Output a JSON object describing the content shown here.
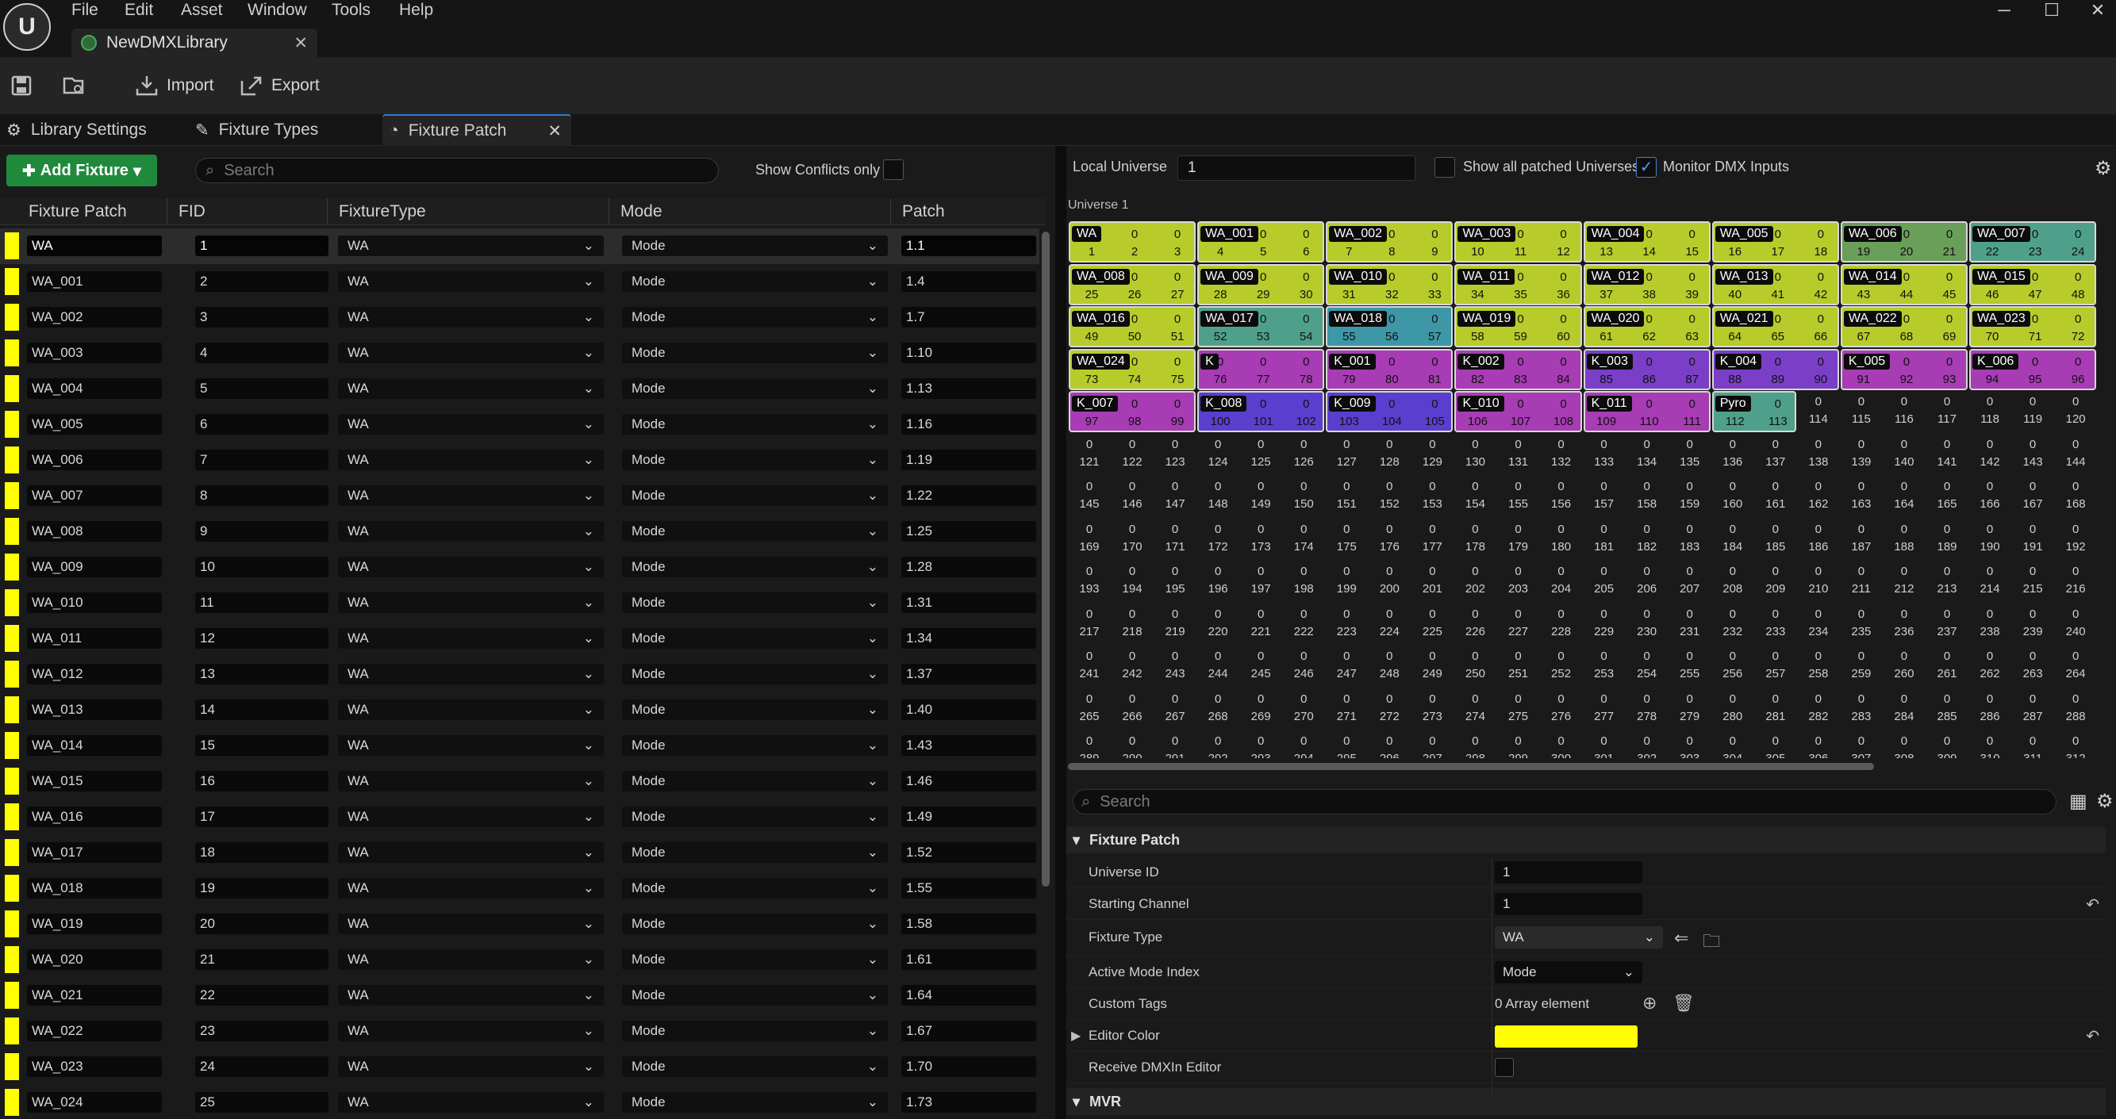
{
  "menu": [
    "File",
    "Edit",
    "Asset",
    "Window",
    "Tools",
    "Help"
  ],
  "logo_text": "U",
  "window_controls": {
    "minimize": "─",
    "maximize": "☐",
    "close": "✕"
  },
  "doc_tab": {
    "title": "NewDMXLibrary",
    "close": "✕"
  },
  "toolbar": {
    "import_label": "Import",
    "export_label": "Export"
  },
  "panel_tabs": {
    "library_settings": "Library Settings",
    "fixture_types": "Fixture Types",
    "fixture_patch": "Fixture Patch",
    "close": "✕"
  },
  "left": {
    "add_fixture_label": "Add Fixture",
    "search_placeholder": "Search",
    "show_conflicts_label": "Show Conflicts only",
    "columns": [
      "Fixture Patch",
      "FID",
      "FixtureType",
      "Mode",
      "Patch"
    ],
    "rows": [
      {
        "name": "WA",
        "fid": "1",
        "type": "WA",
        "mode": "Mode",
        "patch": "1.1"
      },
      {
        "name": "WA_001",
        "fid": "2",
        "type": "WA",
        "mode": "Mode",
        "patch": "1.4"
      },
      {
        "name": "WA_002",
        "fid": "3",
        "type": "WA",
        "mode": "Mode",
        "patch": "1.7"
      },
      {
        "name": "WA_003",
        "fid": "4",
        "type": "WA",
        "mode": "Mode",
        "patch": "1.10"
      },
      {
        "name": "WA_004",
        "fid": "5",
        "type": "WA",
        "mode": "Mode",
        "patch": "1.13"
      },
      {
        "name": "WA_005",
        "fid": "6",
        "type": "WA",
        "mode": "Mode",
        "patch": "1.16"
      },
      {
        "name": "WA_006",
        "fid": "7",
        "type": "WA",
        "mode": "Mode",
        "patch": "1.19"
      },
      {
        "name": "WA_007",
        "fid": "8",
        "type": "WA",
        "mode": "Mode",
        "patch": "1.22"
      },
      {
        "name": "WA_008",
        "fid": "9",
        "type": "WA",
        "mode": "Mode",
        "patch": "1.25"
      },
      {
        "name": "WA_009",
        "fid": "10",
        "type": "WA",
        "mode": "Mode",
        "patch": "1.28"
      },
      {
        "name": "WA_010",
        "fid": "11",
        "type": "WA",
        "mode": "Mode",
        "patch": "1.31"
      },
      {
        "name": "WA_011",
        "fid": "12",
        "type": "WA",
        "mode": "Mode",
        "patch": "1.34"
      },
      {
        "name": "WA_012",
        "fid": "13",
        "type": "WA",
        "mode": "Mode",
        "patch": "1.37"
      },
      {
        "name": "WA_013",
        "fid": "14",
        "type": "WA",
        "mode": "Mode",
        "patch": "1.40"
      },
      {
        "name": "WA_014",
        "fid": "15",
        "type": "WA",
        "mode": "Mode",
        "patch": "1.43"
      },
      {
        "name": "WA_015",
        "fid": "16",
        "type": "WA",
        "mode": "Mode",
        "patch": "1.46"
      },
      {
        "name": "WA_016",
        "fid": "17",
        "type": "WA",
        "mode": "Mode",
        "patch": "1.49"
      },
      {
        "name": "WA_017",
        "fid": "18",
        "type": "WA",
        "mode": "Mode",
        "patch": "1.52"
      },
      {
        "name": "WA_018",
        "fid": "19",
        "type": "WA",
        "mode": "Mode",
        "patch": "1.55"
      },
      {
        "name": "WA_019",
        "fid": "20",
        "type": "WA",
        "mode": "Mode",
        "patch": "1.58"
      },
      {
        "name": "WA_020",
        "fid": "21",
        "type": "WA",
        "mode": "Mode",
        "patch": "1.61"
      },
      {
        "name": "WA_021",
        "fid": "22",
        "type": "WA",
        "mode": "Mode",
        "patch": "1.64"
      },
      {
        "name": "WA_022",
        "fid": "23",
        "type": "WA",
        "mode": "Mode",
        "patch": "1.67"
      },
      {
        "name": "WA_023",
        "fid": "24",
        "type": "WA",
        "mode": "Mode",
        "patch": "1.70"
      },
      {
        "name": "WA_024",
        "fid": "25",
        "type": "WA",
        "mode": "Mode",
        "patch": "1.73"
      }
    ]
  },
  "right": {
    "local_universe_label": "Local Universe",
    "local_universe_value": "1",
    "show_all_label": "Show all patched Universes",
    "monitor_label": "Monitor DMX Inputs",
    "monitor_checked": true,
    "universe_title": "Universe 1",
    "channel_value": "0",
    "patches": [
      {
        "label": "WA",
        "start": 1,
        "count": 3,
        "color": "#b7cc2a"
      },
      {
        "label": "WA_001",
        "start": 4,
        "count": 3,
        "color": "#b7cc2a"
      },
      {
        "label": "WA_002",
        "start": 7,
        "count": 3,
        "color": "#b7cc2a"
      },
      {
        "label": "WA_003",
        "start": 10,
        "count": 3,
        "color": "#b7cc2a"
      },
      {
        "label": "WA_004",
        "start": 13,
        "count": 3,
        "color": "#b7cc2a"
      },
      {
        "label": "WA_005",
        "start": 16,
        "count": 3,
        "color": "#b7cc2a"
      },
      {
        "label": "WA_006",
        "start": 19,
        "count": 3,
        "color": "#6a9f5a"
      },
      {
        "label": "WA_007",
        "start": 22,
        "count": 3,
        "color": "#4fa08a"
      },
      {
        "label": "WA_008",
        "start": 25,
        "count": 3,
        "color": "#b7cc2a"
      },
      {
        "label": "WA_009",
        "start": 28,
        "count": 3,
        "color": "#b7cc2a"
      },
      {
        "label": "WA_010",
        "start": 31,
        "count": 3,
        "color": "#b7cc2a"
      },
      {
        "label": "WA_011",
        "start": 34,
        "count": 3,
        "color": "#b7cc2a"
      },
      {
        "label": "WA_012",
        "start": 37,
        "count": 3,
        "color": "#b7cc2a"
      },
      {
        "label": "WA_013",
        "start": 40,
        "count": 3,
        "color": "#b7cc2a"
      },
      {
        "label": "WA_014",
        "start": 43,
        "count": 3,
        "color": "#b7cc2a"
      },
      {
        "label": "WA_015",
        "start": 46,
        "count": 3,
        "color": "#b7cc2a"
      },
      {
        "label": "WA_016",
        "start": 49,
        "count": 3,
        "color": "#b7cc2a"
      },
      {
        "label": "WA_017",
        "start": 52,
        "count": 3,
        "color": "#4fa08a"
      },
      {
        "label": "WA_018",
        "start": 55,
        "count": 3,
        "color": "#3d97a7"
      },
      {
        "label": "WA_019",
        "start": 58,
        "count": 3,
        "color": "#b7cc2a"
      },
      {
        "label": "WA_020",
        "start": 61,
        "count": 3,
        "color": "#b7cc2a"
      },
      {
        "label": "WA_021",
        "start": 64,
        "count": 3,
        "color": "#b7cc2a"
      },
      {
        "label": "WA_022",
        "start": 67,
        "count": 3,
        "color": "#b7cc2a"
      },
      {
        "label": "WA_023",
        "start": 70,
        "count": 3,
        "color": "#b7cc2a"
      },
      {
        "label": "WA_024",
        "start": 73,
        "count": 3,
        "color": "#b7cc2a"
      },
      {
        "label": "K",
        "start": 76,
        "count": 3,
        "color": "#a83cb5"
      },
      {
        "label": "K_001",
        "start": 79,
        "count": 3,
        "color": "#a83cb5"
      },
      {
        "label": "K_002",
        "start": 82,
        "count": 3,
        "color": "#a83cb5"
      },
      {
        "label": "K_003",
        "start": 85,
        "count": 3,
        "color": "#7a3fc6"
      },
      {
        "label": "K_004",
        "start": 88,
        "count": 3,
        "color": "#7a3fc6"
      },
      {
        "label": "K_005",
        "start": 91,
        "count": 3,
        "color": "#a83cb5"
      },
      {
        "label": "K_006",
        "start": 94,
        "count": 3,
        "color": "#a83cb5"
      },
      {
        "label": "K_007",
        "start": 97,
        "count": 3,
        "color": "#a83cb5"
      },
      {
        "label": "K_008",
        "start": 100,
        "count": 3,
        "color": "#5a3fcf"
      },
      {
        "label": "K_009",
        "start": 103,
        "count": 3,
        "color": "#5a3fcf"
      },
      {
        "label": "K_010",
        "start": 106,
        "count": 3,
        "color": "#a83cb5"
      },
      {
        "label": "K_011",
        "start": 109,
        "count": 3,
        "color": "#a83cb5"
      },
      {
        "label": "Pyro",
        "start": 112,
        "count": 2,
        "color": "#4fa08a"
      }
    ],
    "details": {
      "search_placeholder": "Search",
      "section_fixture_patch": "Fixture Patch",
      "section_mvr": "MVR",
      "props": [
        {
          "label": "Universe ID",
          "value": "1"
        },
        {
          "label": "Starting Channel",
          "value": "1"
        },
        {
          "label": "Fixture Type",
          "value": "WA"
        },
        {
          "label": "Active Mode Index",
          "value": "Mode"
        },
        {
          "label": "Custom Tags",
          "value": "0 Array element"
        },
        {
          "label": "Editor Color",
          "value": ""
        },
        {
          "label": "Receive DMXIn Editor",
          "value": ""
        }
      ],
      "editor_color": "#ffff00"
    }
  }
}
